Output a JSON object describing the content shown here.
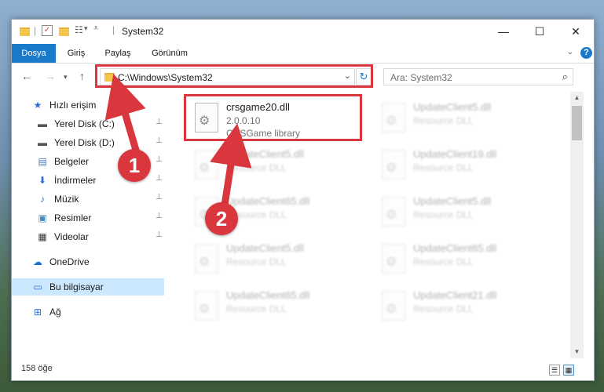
{
  "window": {
    "title": "System32",
    "controls": {
      "minimize": "—",
      "maximize": "☐",
      "close": "✕"
    }
  },
  "ribbon": {
    "tabs": [
      {
        "label": "Dosya",
        "active": true
      },
      {
        "label": "Giriş",
        "active": false
      },
      {
        "label": "Paylaş",
        "active": false
      },
      {
        "label": "Görünüm",
        "active": false
      }
    ],
    "help": "?"
  },
  "address": {
    "path": "C:\\Windows\\System32"
  },
  "search": {
    "placeholder": "Ara: System32"
  },
  "nav": {
    "items": [
      {
        "label": "Hızlı erişim",
        "icon": "star-icon",
        "glyph": "★",
        "color": "#2b6fd6",
        "pinned": false,
        "indent": false
      },
      {
        "label": "Yerel Disk (C:)",
        "icon": "drive-icon",
        "glyph": "▬",
        "color": "#555555",
        "pinned": true,
        "indent": true
      },
      {
        "label": "Yerel Disk (D:)",
        "icon": "drive-icon",
        "glyph": "▬",
        "color": "#555555",
        "pinned": true,
        "indent": true
      },
      {
        "label": "Belgeler",
        "icon": "document-icon",
        "glyph": "▤",
        "color": "#4a78b8",
        "pinned": true,
        "indent": true
      },
      {
        "label": "İndirmeler",
        "icon": "download-icon",
        "glyph": "⬇",
        "color": "#2b6fd6",
        "pinned": true,
        "indent": true
      },
      {
        "label": "Müzik",
        "icon": "music-icon",
        "glyph": "♪",
        "color": "#2b6fd6",
        "pinned": true,
        "indent": true
      },
      {
        "label": "Resimler",
        "icon": "pictures-icon",
        "glyph": "▣",
        "color": "#4a8ab8",
        "pinned": true,
        "indent": true
      },
      {
        "label": "Videolar",
        "icon": "video-icon",
        "glyph": "▦",
        "color": "#333333",
        "pinned": true,
        "indent": true
      },
      {
        "label": "OneDrive",
        "icon": "cloud-icon",
        "glyph": "☁",
        "color": "#1e6fd0",
        "pinned": false,
        "indent": false
      },
      {
        "label": "Bu bilgisayar",
        "icon": "computer-icon",
        "glyph": "▭",
        "color": "#2b6fd6",
        "pinned": false,
        "indent": false,
        "selected": true
      },
      {
        "label": "Ağ",
        "icon": "network-icon",
        "glyph": "⊞",
        "color": "#2b6fd6",
        "pinned": false,
        "indent": false
      }
    ],
    "pin_glyph": "📌"
  },
  "files": {
    "highlighted": {
      "name": "crsgame20.dll",
      "version": "2.0.0.10",
      "description": "CRSGame library"
    },
    "left_column": [
      {
        "name": "UpdateClient5.dll",
        "description": "Resource DLL"
      },
      {
        "name": "UpdateClient65.dll",
        "description": "Resource DLL"
      },
      {
        "name": "UpdateClient5.dll",
        "description": "Resource DLL"
      },
      {
        "name": "UpdateClient65.dll",
        "description": "Resource DLL"
      }
    ],
    "right_column": [
      {
        "name": "UpdateClient5.dll",
        "description": "Resource DLL"
      },
      {
        "name": "UpdateClient19.dll",
        "description": "Resource DLL"
      },
      {
        "name": "UpdateClient5.dll",
        "description": "Resource DLL"
      },
      {
        "name": "UpdateClient65.dll",
        "description": "Resource DLL"
      },
      {
        "name": "UpdateClient21.dll",
        "description": "Resource DLL"
      }
    ]
  },
  "status": {
    "count": "158 öğe"
  },
  "callouts": {
    "one": "1",
    "two": "2"
  },
  "colors": {
    "accent": "#1979ca",
    "highlight": "#d9363e",
    "selected": "#cce8ff"
  }
}
